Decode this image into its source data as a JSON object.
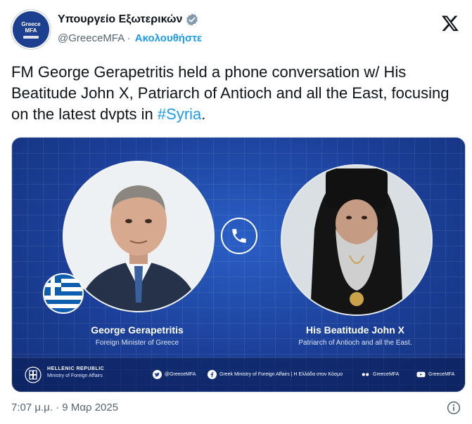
{
  "account": {
    "display_name": "Υπουργείο Εξωτερικών",
    "handle": "@GreeceMFA",
    "separator": "·",
    "follow_label": "Ακολουθήστε",
    "avatar_text": "Greece\nMFA",
    "verified_icon": "verified-badge-icon"
  },
  "tweet": {
    "text_before": "FM George Gerapetritis held a phone conversation w/ His Beatitude John X, Patriarch of Antioch and all the East, focusing on the latest dvpts in ",
    "hashtag": "#Syria",
    "text_after": ".",
    "timestamp": "7:07 μ.μ. · 9 Μαρ 2025"
  },
  "media": {
    "left_person": {
      "name": "George Gerapetritis",
      "role": "Foreign Minister of Greece"
    },
    "right_person": {
      "name": "His Beatitude John X",
      "role": "Patriarch of Antioch and all the East."
    },
    "footer": {
      "title": "HELLENIC REPUBLIC",
      "subtitle": "Ministry of Foreign Affairs",
      "twitter": "@GreeceMFA",
      "facebook": "Greek Ministry of Foreign Affairs | Η Ελλάδα στον Κόσμο",
      "flickr": "GreeceMFA",
      "youtube": "GreeceMFA"
    }
  },
  "colors": {
    "link": "#1d9bf0",
    "media_bg": "#1b3f98",
    "muted": "#536471"
  }
}
